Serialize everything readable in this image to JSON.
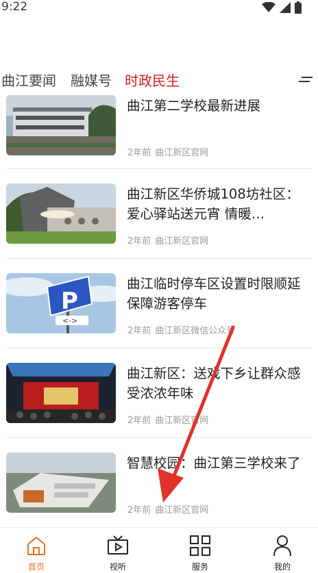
{
  "status": {
    "time": "9:22"
  },
  "tabs": [
    {
      "label": "曲江要闻",
      "active": false
    },
    {
      "label": "融媒号",
      "active": false
    },
    {
      "label": "时政民生",
      "active": true
    }
  ],
  "news": [
    {
      "title": "曲江第二学校最新进展",
      "age": "2年前",
      "source": "曲江新区官网"
    },
    {
      "title": "曲江新区华侨城108坊社区：爱心驿站送元宵  情暖…",
      "age": "2年前",
      "source": "曲江新区官网"
    },
    {
      "title": "曲江临时停车区设置时限顺延  保障游客停车",
      "age": "2年前",
      "source": "曲江新区微信公众号"
    },
    {
      "title": "曲江新区：送戏下乡让群众感受浓浓年味",
      "age": "2年前",
      "source": "曲江新区官网"
    },
    {
      "title": "智慧校园：曲江第三学校来了",
      "age": "2年前",
      "source": "曲江新区官网"
    }
  ],
  "bottom_nav": [
    {
      "label": "首页",
      "icon": "home-icon",
      "active": true
    },
    {
      "label": "视听",
      "icon": "tv-play-icon",
      "active": false
    },
    {
      "label": "服务",
      "icon": "grid-icon",
      "active": false
    },
    {
      "label": "我的",
      "icon": "person-icon",
      "active": false
    }
  ],
  "colors": {
    "accent_red": "#d6201a",
    "nav_active": "#e8741e",
    "annotation": "#e0312b"
  }
}
